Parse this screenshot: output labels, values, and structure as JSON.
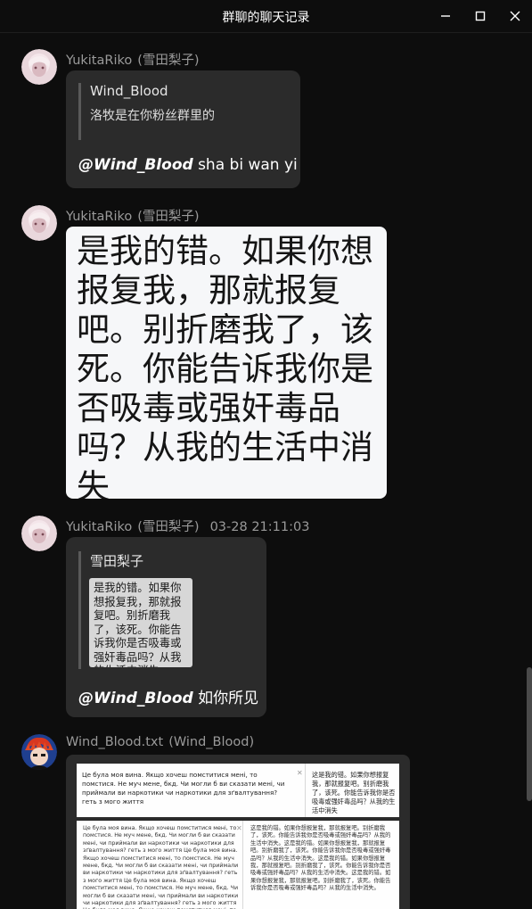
{
  "window": {
    "title": "群聊的聊天记录",
    "icons": [
      "minimize-icon",
      "maximize-icon",
      "close-icon"
    ]
  },
  "messages": [
    {
      "sender": "YukitaRiko",
      "nickname": "(雪田梨子)",
      "quote": {
        "author": "Wind_Blood",
        "text": "洛牧是在你粉丝群里的"
      },
      "reply": {
        "mention": "@Wind_Blood",
        "text": " sha bi wan yi"
      }
    },
    {
      "sender": "YukitaRiko",
      "nickname": "(雪田梨子)",
      "image_text": "是我的错。如果你想报复我，那就报复吧。别折磨我了，该死。你能告诉我你是否吸毒或强奸毒品吗？从我的生活中消失"
    },
    {
      "sender": "YukitaRiko",
      "nickname": "(雪田梨子)",
      "time": "03-28 21:11:03",
      "quote": {
        "author": "雪田梨子",
        "image_text": "是我的错。如果你想报复我，那就报复吧。别折磨我了，该死。你能告诉我你是否吸毒或强奸毒品吗？从我的生活中消失"
      },
      "reply": {
        "mention": "@Wind_Blood",
        "text": " 如你所见"
      }
    },
    {
      "sender": "Wind_Blood.txt",
      "nickname": "(Wind_Blood)",
      "doc": {
        "top_left": "Це була моя вина. Якщо хочеш помститися мені, то помстися. Не муч мене, бкд. Чи могли б ви сказати мені, чи приймали ви наркотики чи наркотики для зґвалтування? геть з мого життя",
        "top_right": "这是我的错。如果你想报复我，那就报复吧。别折磨我了，该死。你能告诉我你是否吸毒或强奸毒品吗？从我的生活中消失",
        "bottom_left": "Це була моя вина. Якщо хочеш помститися мені, то помстися. Не муч мене, бкд. Чи могли б ви сказати мені, чи приймали ви наркотики чи наркотики для зґвалтування? геть з мого життя Це була моя вина. Якщо хочеш помститися мені, то помстися. Не муч мене, бкд. Чи могли б ви сказати мені, чи приймали ви наркотики чи наркотики для зґвалтування? геть з мого життя Це була моя вина. Якщо хочеш помститися мені, то помстися. Не муч мене, бкд. Чи могли б ви сказати мені, чи приймали ви наркотики чи наркотики для зґвалтування? геть з мого життя Це була моя вина. Якщо хочеш помститися мені, то помстися. Не муч мене, бкд. Чи могли б ви сказати мені, чи приймали ви наркотики чи наркотики для зґвалтування? геть з мого життя Це була моя вина. Якщо хочеш помститися мені, то помстися.",
        "bottom_right": "这是我的错。如果你想报复我，那就报复吧。别折磨我了，该死。你能告诉我你是否吸毒或强奸毒品吗？从我的生活中消失。这是我的错。如果你想报复我，那就报复吧。别折磨我了，该死。你能告诉我你是否吸毒或强奸毒品吗？从我的生活中消失。这是我的错。如果你想报复我，那就报复吧。别折磨我了，该死。你能告诉我你是否吸毒或强奸毒品吗？从我的生活中消失。这是我的错。如果你想报复我，那就报复吧。别折磨我了，该死。你能告诉我你是否吸毒或强奸毒品吗？从我的生活中消失。"
      }
    }
  ],
  "colors": {
    "background": "#0d0d0d",
    "bubble": "#2b2b2b",
    "sender_text": "#9a9a9a",
    "message_text": "#ffffff"
  }
}
